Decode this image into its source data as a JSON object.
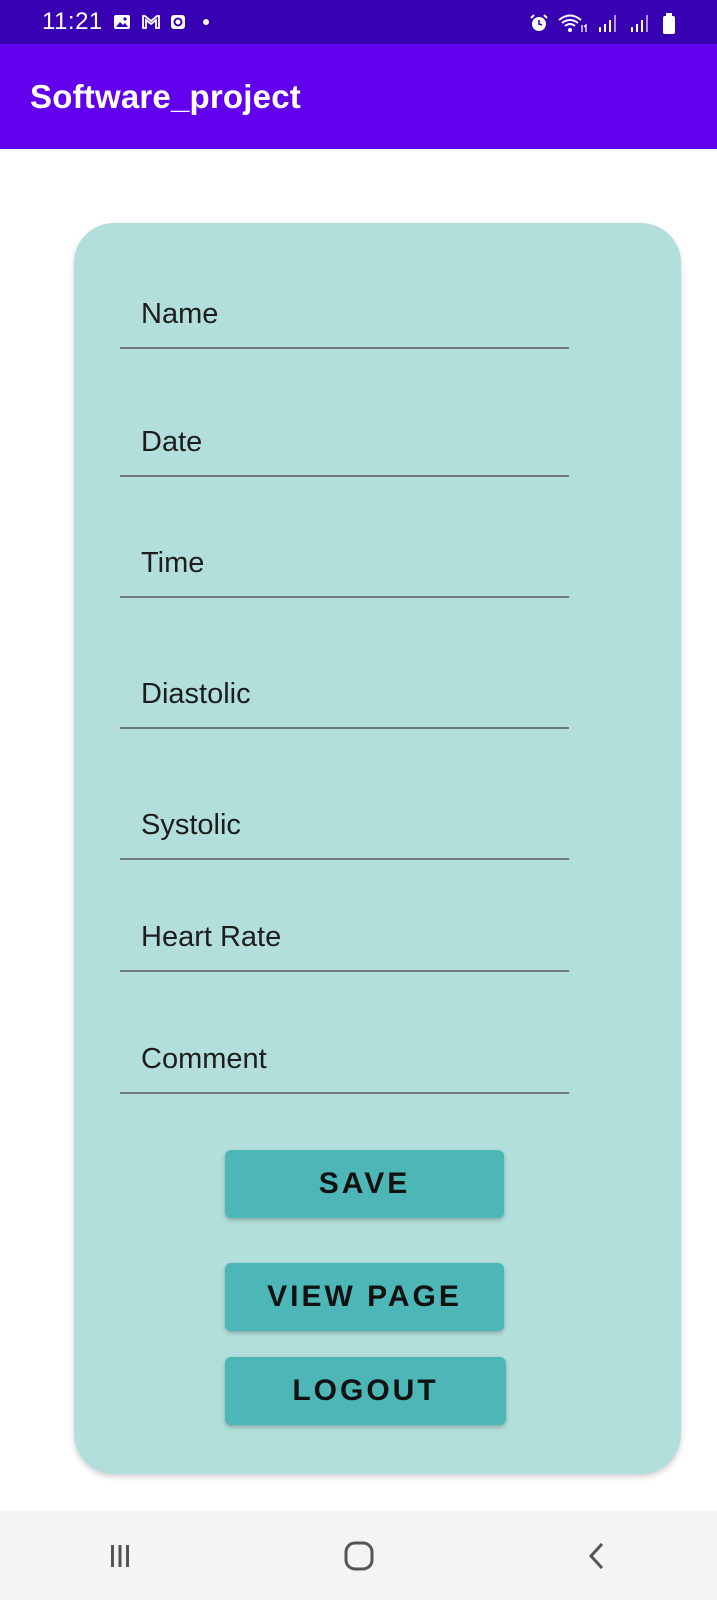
{
  "status_bar": {
    "time": "11:21",
    "left_icons": [
      "gallery-icon",
      "gmail-icon",
      "app-notification-icon",
      "dot-icon"
    ],
    "right_icons": [
      "alarm-icon",
      "wifi-icon",
      "signal-icon",
      "signal-icon-2",
      "battery-icon"
    ]
  },
  "app_bar": {
    "title": "Software_project",
    "color": "#6200ee",
    "status_color": "#3700b3"
  },
  "form": {
    "fields": [
      {
        "placeholder": "Name",
        "value": ""
      },
      {
        "placeholder": "Date",
        "value": ""
      },
      {
        "placeholder": "Time",
        "value": ""
      },
      {
        "placeholder": "Diastolic",
        "value": ""
      },
      {
        "placeholder": "Systolic",
        "value": ""
      },
      {
        "placeholder": "Heart Rate",
        "value": ""
      },
      {
        "placeholder": "Comment",
        "value": ""
      }
    ],
    "card_color": "#b2dfdb"
  },
  "buttons": {
    "save": "SAVE",
    "view_page": "VIEW PAGE",
    "logout": "LOGOUT",
    "color": "#4db6b6"
  },
  "nav_bar": {
    "icons": [
      "recents-icon",
      "home-icon",
      "back-icon"
    ]
  }
}
